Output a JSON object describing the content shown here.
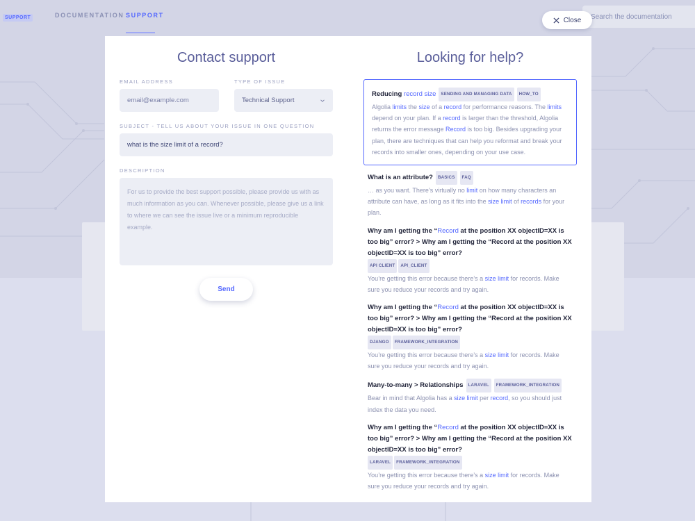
{
  "nav": {
    "badge": "SUPPORT",
    "links": [
      "DOCUMENTATION",
      "SUPPORT"
    ],
    "search_placeholder": "Search the documentation"
  },
  "close_label": "Close",
  "contact": {
    "title": "Contact support",
    "email_label": "EMAIL ADDRESS",
    "email_placeholder": "email@example.com",
    "type_label": "TYPE OF ISSUE",
    "type_value": "Technical Support",
    "subject_label": "SUBJECT - TELL US ABOUT YOUR ISSUE IN ONE QUESTION",
    "subject_value": "what is the size limit of a record?",
    "description_label": "DESCRIPTION",
    "description_placeholder": "For us to provide the best support possible, please provide us with as much information as you can. Whenever possible, please give us a link to where we can see the issue live or a minimum reproducible example.",
    "send_label": "Send"
  },
  "help": {
    "title": "Looking for help?",
    "results": [
      {
        "title_parts": [
          [
            "Reducing ",
            false
          ],
          [
            "record size",
            true
          ]
        ],
        "tags": [
          "SENDING AND MANAGING DATA",
          "HOW_TO"
        ],
        "tags_inline": true,
        "highlighted": true,
        "body_parts": [
          [
            "Algolia ",
            false
          ],
          [
            "limits",
            true
          ],
          [
            " the ",
            false
          ],
          [
            "size",
            true
          ],
          [
            " of a ",
            false
          ],
          [
            "record",
            true
          ],
          [
            " for performance reasons. The ",
            false
          ],
          [
            "limits",
            true
          ],
          [
            " depend on your plan. If a ",
            false
          ],
          [
            "record",
            true
          ],
          [
            " is larger than the threshold, Algolia returns the error message ",
            false
          ],
          [
            "Record",
            true
          ],
          [
            " is too big. Besides upgrading your plan, there are techniques that can help you reformat and break your records into smaller ones, depending on your use case.",
            false
          ]
        ]
      },
      {
        "title_parts": [
          [
            "What is an attribute?",
            false
          ]
        ],
        "tags": [
          "BASICS",
          "FAQ"
        ],
        "tags_inline": true,
        "highlighted": false,
        "body_parts": [
          [
            "… as you want. There’s virtually no ",
            false
          ],
          [
            "limit",
            true
          ],
          [
            " on how many characters an attribute can have, as long as it fits into the ",
            false
          ],
          [
            "size limit",
            true
          ],
          [
            " of ",
            false
          ],
          [
            "records",
            true
          ],
          [
            " for your plan.",
            false
          ]
        ]
      },
      {
        "title_parts": [
          [
            "Why am I getting the “",
            false
          ],
          [
            "Record",
            true
          ],
          [
            " at the position XX objectID=XX is too big” error? > Why am I getting the “Record at the position XX objectID=XX is too big” error?",
            false
          ]
        ],
        "tags": [
          "API CLIENT",
          "API_CLIENT"
        ],
        "tags_inline": false,
        "highlighted": false,
        "body_parts": [
          [
            "You’re getting this error because there’s a ",
            false
          ],
          [
            "size limit",
            true
          ],
          [
            " for records. Make sure you reduce your records and try again.",
            false
          ]
        ]
      },
      {
        "title_parts": [
          [
            "Why am I getting the “",
            false
          ],
          [
            "Record",
            true
          ],
          [
            " at the position XX objectID=XX is too big” error? > Why am I getting the “Record at the position XX objectID=XX is too big” error?",
            false
          ]
        ],
        "tags": [
          "DJANGO",
          "FRAMEWORK_INTEGRATION"
        ],
        "tags_inline": false,
        "highlighted": false,
        "body_parts": [
          [
            "You’re getting this error because there’s a ",
            false
          ],
          [
            "size limit",
            true
          ],
          [
            " for records. Make sure you reduce your records and try again.",
            false
          ]
        ]
      },
      {
        "title_parts": [
          [
            "Many-to-many > Relationships",
            false
          ]
        ],
        "tags": [
          "LARAVEL",
          "FRAMEWORK_INTEGRATION"
        ],
        "tags_inline": true,
        "highlighted": false,
        "body_parts": [
          [
            "Bear in mind that Algolia has a ",
            false
          ],
          [
            "size limit",
            true
          ],
          [
            " per ",
            false
          ],
          [
            "record",
            true
          ],
          [
            ", so you should just index the data you need.",
            false
          ]
        ]
      },
      {
        "title_parts": [
          [
            "Why am I getting the “",
            false
          ],
          [
            "Record",
            true
          ],
          [
            " at the position XX objectID=XX is too big” error? > Why am I getting the “Record at the position XX objectID=XX is too big” error?",
            false
          ]
        ],
        "tags": [
          "LARAVEL",
          "FRAMEWORK_INTEGRATION"
        ],
        "tags_inline": false,
        "highlighted": false,
        "body_parts": [
          [
            "You’re getting this error because there’s a ",
            false
          ],
          [
            "size limit",
            true
          ],
          [
            " for records. Make sure you reduce your records and try again.",
            false
          ]
        ]
      }
    ]
  },
  "colors": {
    "accent": "#5468ff",
    "title": "#5a5e9a",
    "text_dark": "#23263b",
    "text_muted": "#8c91b0",
    "field_bg": "#eceef5"
  },
  "icons": {
    "close": "close-icon",
    "chevron": "chevron-down-icon"
  }
}
